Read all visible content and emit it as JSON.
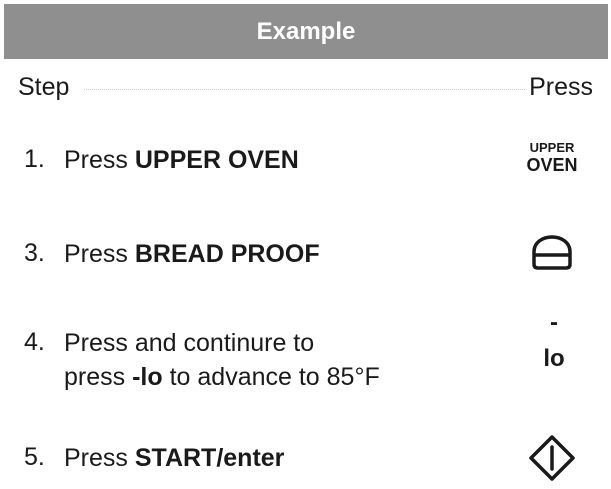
{
  "header": {
    "title": "Example"
  },
  "columns": {
    "step": "Step",
    "press": "Press"
  },
  "steps": [
    {
      "number": "1.",
      "prefix": "Press ",
      "bold": "UPPER OVEN",
      "key_icon": "upper-oven-key",
      "key_line1": "UPPER",
      "key_line2": "OVEN"
    },
    {
      "number": "3.",
      "prefix": "Press ",
      "bold": "BREAD PROOF",
      "key_icon": "bread-icon"
    },
    {
      "number": "4.",
      "line1": "Press and continure to",
      "line2_prefix": "press ",
      "bold": "-lo",
      "line2_suffix": " to advance to 85°F",
      "key_icon": "minus-lo-key",
      "key_line1": "-",
      "key_line2": "lo"
    },
    {
      "number": "5.",
      "prefix": "Press ",
      "bold": "START/enter",
      "key_icon": "start-diamond-icon"
    }
  ]
}
